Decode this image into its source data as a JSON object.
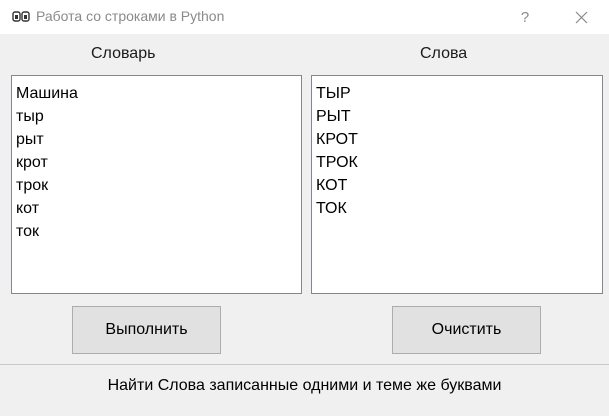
{
  "window": {
    "title": "Работа со строками в Python",
    "icon": "app-logo-icon",
    "help_label": "?",
    "close_label": "✕"
  },
  "labels": {
    "dictionary": "Словарь",
    "words": "Слова"
  },
  "dictionary_list": [
    "Машина",
    "тыр",
    "рыт",
    "крот",
    "трок",
    "кот",
    "ток"
  ],
  "words_list": [
    "ТЫР",
    "РЫТ",
    "КРОТ",
    "ТРОК",
    "КОТ",
    "ТОК"
  ],
  "buttons": {
    "run_label": "Выполнить",
    "clear_label": "Очистить"
  },
  "status_text": "Найти Слова записанные одними и теме же буквами"
}
